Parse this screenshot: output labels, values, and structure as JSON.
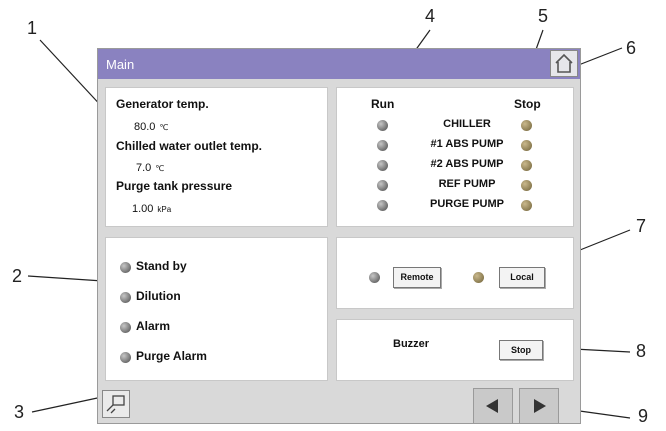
{
  "callouts": [
    "1",
    "2",
    "3",
    "4",
    "5",
    "6",
    "7",
    "8",
    "9"
  ],
  "titlebar": {
    "title": "Main",
    "home_icon": "home-icon"
  },
  "info": {
    "generator_label": "Generator temp.",
    "generator_value": "80.0",
    "generator_unit": "℃",
    "chilled_label": "Chilled water outlet temp.",
    "chilled_value": "7.0",
    "chilled_unit": "℃",
    "purge_label": "Purge tank pressure",
    "purge_value": "1.00",
    "purge_unit": "kPa"
  },
  "run_stop": {
    "run_header": "Run",
    "stop_header": "Stop",
    "items": [
      "CHILLER",
      "#1 ABS PUMP",
      "#2 ABS PUMP",
      "REF PUMP",
      "PURGE PUMP"
    ]
  },
  "states": [
    "Stand by",
    "Dilution",
    "Alarm",
    "Purge Alarm"
  ],
  "mode": {
    "remote_label": "Remote",
    "local_label": "Local"
  },
  "buzzer": {
    "label": "Buzzer",
    "stop_label": "Stop"
  },
  "nav": {
    "prev_icon": "left-arrow-icon",
    "next_icon": "right-arrow-icon",
    "settings_icon": "panel-settings-icon"
  },
  "colors": {
    "titlebar": "#8a82c0",
    "run_led": "#6e6e6e",
    "stop_led": "#8a7b50"
  }
}
